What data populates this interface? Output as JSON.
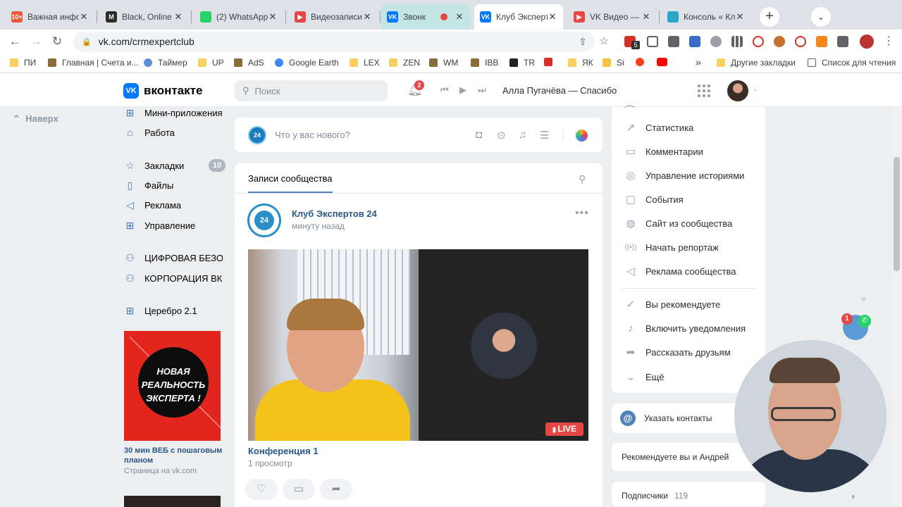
{
  "browser": {
    "tabs": [
      {
        "title": "Важная инфо",
        "favicon_color": "#e85a3a",
        "favicon_text": "10+"
      },
      {
        "title": "Black, Online",
        "favicon_color": "#2b2b2b",
        "favicon_text": "M"
      },
      {
        "title": "(2) WhatsApp",
        "favicon_color": "#25d366",
        "favicon_text": ""
      },
      {
        "title": "Видеозаписи",
        "favicon_color": "#e64646",
        "favicon_text": "▶"
      },
      {
        "title": "Звонк",
        "favicon_color": "#0077ff",
        "favicon_text": "VK"
      },
      {
        "title": "Клуб Эксперт",
        "favicon_color": "#0077ff",
        "favicon_text": "VK"
      },
      {
        "title": "VK Видео — с",
        "favicon_color": "#e64646",
        "favicon_text": "▶"
      },
      {
        "title": "Консоль « Клу",
        "favicon_color": "#26a8c8",
        "favicon_text": ""
      }
    ],
    "new_tab_label": "+",
    "url": "vk.com/crmexpertclub",
    "extension_badge": "5"
  },
  "bookmarks": [
    {
      "label": "ПИ",
      "icon": "folder-icon"
    },
    {
      "label": "Главная | Счета и...",
      "icon": "site-icon"
    },
    {
      "label": "Таймер",
      "icon": "timer-icon"
    },
    {
      "label": "UP",
      "icon": "folder-icon"
    },
    {
      "label": "AdS",
      "icon": "site-icon"
    },
    {
      "label": "Google Earth",
      "icon": "globe-icon"
    },
    {
      "label": "LEX",
      "icon": "folder-icon"
    },
    {
      "label": "ZEN",
      "icon": "folder-icon"
    },
    {
      "label": "WM",
      "icon": "site-icon"
    },
    {
      "label": "IBB",
      "icon": "site-icon"
    },
    {
      "label": "TR",
      "icon": "arrow-icon"
    },
    {
      "label": "",
      "icon": "gmail-icon"
    },
    {
      "label": "ЯК",
      "icon": "folder-icon"
    },
    {
      "label": "Si",
      "icon": "star-icon"
    },
    {
      "label": "",
      "icon": "yandex-icon"
    },
    {
      "label": "",
      "icon": "youtube-icon"
    }
  ],
  "bookmarks_overflow": "»",
  "bookmarks_other": "Другие закладки",
  "bookmarks_reading": "Список для чтения",
  "vk": {
    "logo_text": "вконтакте",
    "search_placeholder": "Поиск",
    "notifications_count": "2",
    "now_playing": "Алла Пугачёва — Спасибо"
  },
  "left_nav": {
    "scroll_up": "Наверх",
    "items": [
      {
        "label": "Мини-приложения",
        "icon": "apps-icon"
      },
      {
        "label": "Работа",
        "icon": "briefcase-icon"
      },
      {
        "label": "Закладки",
        "icon": "star-icon",
        "count": "10"
      },
      {
        "label": "Файлы",
        "icon": "file-icon"
      },
      {
        "label": "Реклама",
        "icon": "megaphone-icon"
      },
      {
        "label": "Управление",
        "icon": "apps-icon"
      },
      {
        "label": "ЦИФРОВАЯ БЕЗО...",
        "icon": "group-icon"
      },
      {
        "label": "КОРПОРАЦИЯ ВК...",
        "icon": "group-icon"
      },
      {
        "label": "Церебро 2.1",
        "icon": "apps-icon"
      }
    ],
    "ad": {
      "image_text": "НОВАЯ РЕАЛЬНОСТЬ ЭКСПЕРТА !",
      "title": "30 мин ВЕБ с пошаговым планом",
      "subtitle": "Страница на vk.com"
    }
  },
  "composer": {
    "placeholder": "Что у вас нового?",
    "avatar_text": "24"
  },
  "feed": {
    "tab": "Записи сообщества",
    "post": {
      "author": "Клуб Экспертов 24",
      "time": "минуту назад",
      "avatar_text": "24",
      "live_label": "LIVE",
      "video_title": "Конференция 1",
      "views": "1 просмотр"
    }
  },
  "right_menu": {
    "items": [
      {
        "label": "Статистика",
        "icon": "chart-icon"
      },
      {
        "label": "Комментарии",
        "icon": "comment-icon"
      },
      {
        "label": "Управление историями",
        "icon": "stories-icon"
      },
      {
        "label": "События",
        "icon": "event-icon"
      },
      {
        "label": "Сайт из сообщества",
        "icon": "globe-icon"
      },
      {
        "label": "Начать репортаж",
        "icon": "broadcast-icon"
      },
      {
        "label": "Реклама сообщества",
        "icon": "megaphone-icon"
      }
    ],
    "actions": [
      {
        "label": "Вы рекомендуете",
        "icon": "check-icon"
      },
      {
        "label": "Включить уведомления",
        "icon": "bell-icon"
      },
      {
        "label": "Рассказать друзьям",
        "icon": "share-icon"
      },
      {
        "label": "Ещё",
        "icon": "chevron-down-icon"
      }
    ],
    "contacts": "Указать контакты",
    "recommend": "Рекомендуете вы и Андрей",
    "subscribers_label": "Подписчики",
    "subscribers_count": "119"
  },
  "widget": {
    "call_badge": "1"
  }
}
